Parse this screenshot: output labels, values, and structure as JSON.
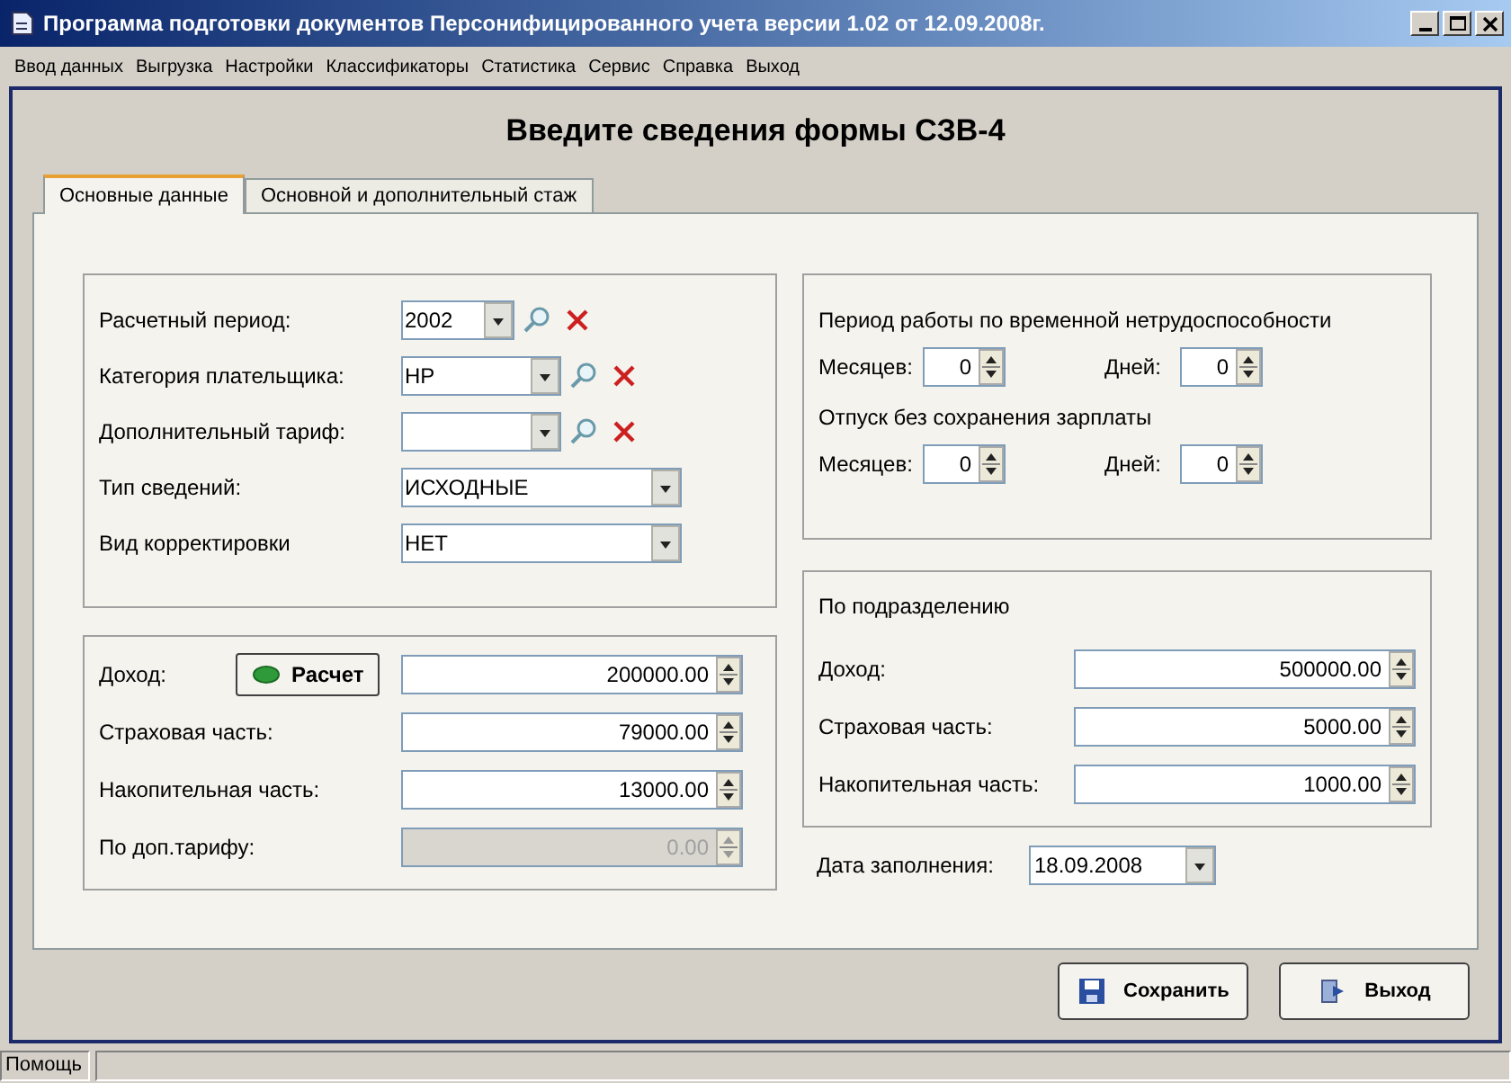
{
  "window": {
    "title": "Программа подготовки документов Персонифицированного учета версии 1.02 от 12.09.2008г."
  },
  "menu": [
    "Ввод данных",
    "Выгрузка",
    "Настройки",
    "Классификаторы",
    "Статистика",
    "Сервис",
    "Справка",
    "Выход"
  ],
  "form_title": "Введите сведения формы СЗВ-4",
  "tabs": [
    {
      "label": "Основные данные",
      "selected": true
    },
    {
      "label": "Основной и дополнительный стаж",
      "selected": false
    }
  ],
  "general": [
    {
      "label": "Расчетный период:",
      "value": "2002",
      "kind": "lookup_short"
    },
    {
      "label": "Категория плательщика:",
      "value": "НР",
      "kind": "lookup"
    },
    {
      "label": "Дополнительный тариф:",
      "kind": "lookup"
    },
    {
      "label": "Тип сведений:",
      "value": "ИСХОДНЫЕ",
      "kind": "combo"
    },
    {
      "label": "Вид корректировки",
      "value": "НЕТ",
      "kind": "combo"
    }
  ],
  "income": {
    "calc_button": "Расчет",
    "rows": [
      {
        "label": "Доход:",
        "value": "200000.00",
        "disabled": false
      },
      {
        "label": "Страховая часть:",
        "value": "79000.00",
        "disabled": false
      },
      {
        "label": "Накопительная часть:",
        "value": "13000.00",
        "disabled": false
      },
      {
        "label": "По доп.тарифу:",
        "value": "0.00",
        "disabled": true
      }
    ]
  },
  "periods": [
    {
      "title": "Период работы по временной нетрудоспособности",
      "months_label": "Месяцев:",
      "months": "0",
      "days_label": "Дней:",
      "days": "0"
    },
    {
      "title": "Отпуск без сохранения зарплаты",
      "months_label": "Месяцев:",
      "months": "0",
      "days_label": "Дней:",
      "days": "0"
    }
  ],
  "subdivision": {
    "title": "По подразделению",
    "rows": [
      {
        "label": "Доход:",
        "value": "500000.00"
      },
      {
        "label": "Страховая часть:",
        "value": "5000.00"
      },
      {
        "label": "Накопительная часть:",
        "value": "1000.00"
      }
    ]
  },
  "fill_date": {
    "label": "Дата заполнения:",
    "value": "18.09.2008"
  },
  "buttons": [
    {
      "label": "Сохранить",
      "kind": "save"
    },
    {
      "label": "Выход",
      "kind": "exit"
    }
  ],
  "status_bar": {
    "text": "Помощь"
  }
}
